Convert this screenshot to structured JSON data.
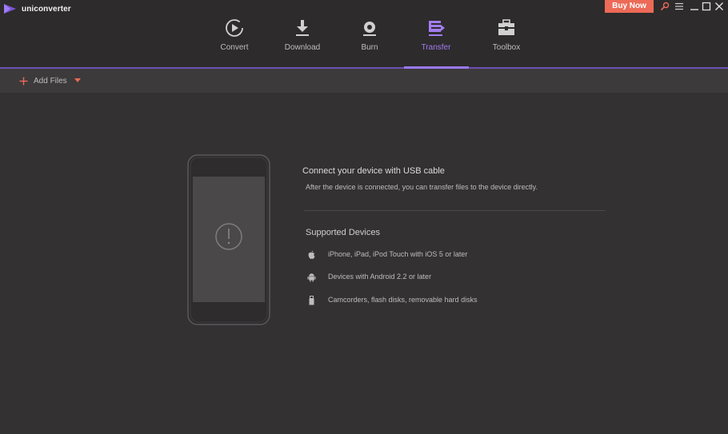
{
  "app": {
    "name": "uniconverter"
  },
  "header": {
    "buy_label": "Buy Now",
    "accent_color": "#9a78ef",
    "buy_color": "#ec6a57",
    "tabs": [
      {
        "label": "Convert",
        "icon": "convert-icon",
        "active": false
      },
      {
        "label": "Download",
        "icon": "download-icon",
        "active": false
      },
      {
        "label": "Burn",
        "icon": "burn-icon",
        "active": false
      },
      {
        "label": "Transfer",
        "icon": "transfer-icon",
        "active": true
      },
      {
        "label": "Toolbox",
        "icon": "toolbox-icon",
        "active": false
      }
    ],
    "window_controls": [
      "search-icon",
      "menu-icon",
      "minimize-icon",
      "maximize-icon",
      "close-icon"
    ]
  },
  "toolbar": {
    "add_files_label": "Add Files"
  },
  "main": {
    "connect_title": "Connect your device with USB cable",
    "connect_description": "After the device is connected, you can transfer files to the device directly.",
    "supported_title": "Supported Devices",
    "devices": [
      {
        "icon": "apple-icon",
        "text": "iPhone, iPad, iPod Touch with iOS 5 or later"
      },
      {
        "icon": "android-icon",
        "text": "Devices with Android 2.2 or later"
      },
      {
        "icon": "usb-drive-icon",
        "text": "Camcorders, flash disks, removable hard disks"
      }
    ]
  }
}
